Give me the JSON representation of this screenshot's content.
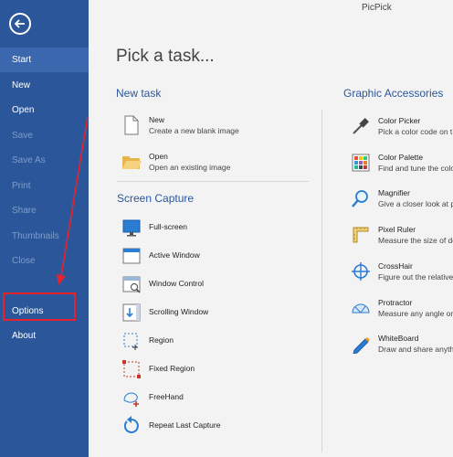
{
  "app_title": "PicPick",
  "sidebar": {
    "items": [
      {
        "label": "Start"
      },
      {
        "label": "New"
      },
      {
        "label": "Open"
      },
      {
        "label": "Save"
      },
      {
        "label": "Save As"
      },
      {
        "label": "Print"
      },
      {
        "label": "Share"
      },
      {
        "label": "Thumbnails"
      },
      {
        "label": "Close"
      },
      {
        "label": "Options"
      },
      {
        "label": "About"
      }
    ]
  },
  "main": {
    "title": "Pick a task...",
    "new_task": {
      "heading": "New task",
      "items": [
        {
          "title": "New",
          "desc": "Create a new blank image"
        },
        {
          "title": "Open",
          "desc": "Open an existing image"
        }
      ]
    },
    "screen_capture": {
      "heading": "Screen Capture",
      "items": [
        {
          "title": "Full-screen"
        },
        {
          "title": "Active Window"
        },
        {
          "title": "Window Control"
        },
        {
          "title": "Scrolling Window"
        },
        {
          "title": "Region"
        },
        {
          "title": "Fixed Region"
        },
        {
          "title": "FreeHand"
        },
        {
          "title": "Repeat Last Capture"
        }
      ]
    },
    "graphic_accessories": {
      "heading": "Graphic Accessories",
      "items": [
        {
          "title": "Color Picker",
          "desc": "Pick a color code on t"
        },
        {
          "title": "Color Palette",
          "desc": "Find and tune the colo"
        },
        {
          "title": "Magnifier",
          "desc": "Give a closer look at p"
        },
        {
          "title": "Pixel Ruler",
          "desc": "Measure the size of de"
        },
        {
          "title": "CrossHair",
          "desc": "Figure out the relative"
        },
        {
          "title": "Protractor",
          "desc": "Measure any angle on"
        },
        {
          "title": "WhiteBoard",
          "desc": "Draw and share anyth"
        }
      ]
    }
  },
  "colors": {
    "sidebar": "#2b579a",
    "accent": "#2b579a",
    "annotation": "#e8222c"
  }
}
